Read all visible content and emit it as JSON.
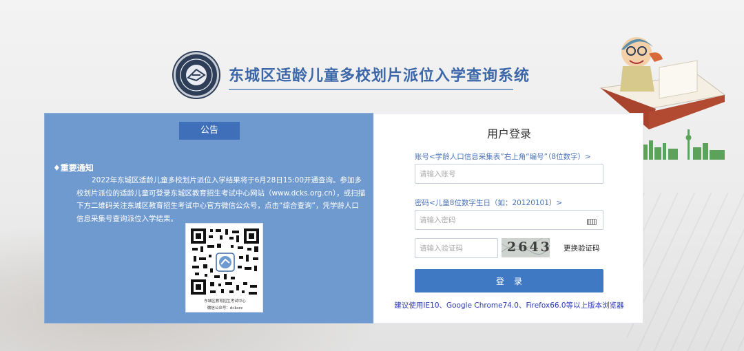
{
  "header": {
    "title": "东城区适龄儿童多校划片派位入学查询系统"
  },
  "notice": {
    "tab_label": "公告",
    "heading": "♦重要通知",
    "body": "2022年东城区适龄儿童多校划片派位入学结果将于6月28日15:00开通查询。参加多校划片派位的适龄儿童可登录东城区教育招生考试中心网站（www.dcks.org.cn），或扫描下方二维码关注东城区教育招生考试中心官方微信公众号，点击“综合查询”，凭学龄人口信息采集号查询派位入学结果。",
    "qr_caption_line1": "东城区教育招生考试中心",
    "qr_caption_line2": "微信公众号：dcksrz"
  },
  "login": {
    "title": "用户登录",
    "account_label": "账号<学龄人口信息采集表”右上角“编号”（8位数字）>",
    "account_placeholder": "请输入账号",
    "password_label": "密码<儿童8位数字生日（如：20120101）>",
    "password_placeholder": "请输入密码",
    "captcha_placeholder": "请输入验证码",
    "captcha_text": "2643",
    "refresh_captcha": "更换验证码",
    "submit_label": "登录",
    "browser_tip": "建议使用IE10、Google Chrome74.0、Firefox66.0等以上版本浏览器"
  },
  "colors": {
    "brand_blue": "#3c67a8",
    "notice_panel": "#6f9ad0",
    "button_blue": "#3f79c4",
    "tip_blue": "#2b3bb8"
  }
}
